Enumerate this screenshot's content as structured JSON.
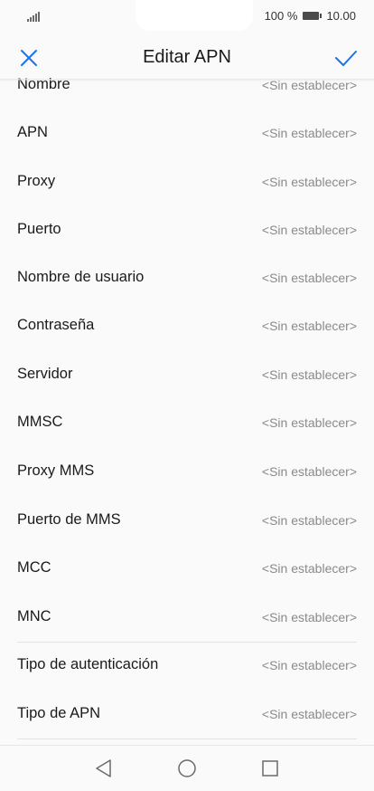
{
  "status_bar": {
    "battery_percent": "100 %",
    "time": "10.00"
  },
  "header": {
    "title": "Editar APN",
    "close_icon": "close-icon",
    "confirm_icon": "check-icon",
    "accent_color": "#1a73e8"
  },
  "fields": [
    {
      "label": "Nombre",
      "value": "<Sin establecer>"
    },
    {
      "label": "APN",
      "value": "<Sin establecer>"
    },
    {
      "label": "Proxy",
      "value": "<Sin establecer>"
    },
    {
      "label": "Puerto",
      "value": "<Sin establecer>"
    },
    {
      "label": "Nombre de usuario",
      "value": "<Sin establecer>"
    },
    {
      "label": "Contraseña",
      "value": "<Sin establecer>"
    },
    {
      "label": "Servidor",
      "value": "<Sin establecer>"
    },
    {
      "label": "MMSC",
      "value": "<Sin establecer>"
    },
    {
      "label": "Proxy MMS",
      "value": "<Sin establecer>"
    },
    {
      "label": "Puerto de MMS",
      "value": "<Sin establecer>"
    },
    {
      "label": "MCC",
      "value": "<Sin establecer>"
    },
    {
      "label": "MNC",
      "value": "<Sin establecer>"
    },
    {
      "label": "Tipo de autenticación",
      "value": "<Sin establecer>"
    },
    {
      "label": "Tipo de APN",
      "value": "<Sin establecer>"
    }
  ],
  "nav_bar": {
    "back_icon": "back-triangle-icon",
    "home_icon": "home-circle-icon",
    "recents_icon": "recents-square-icon"
  }
}
